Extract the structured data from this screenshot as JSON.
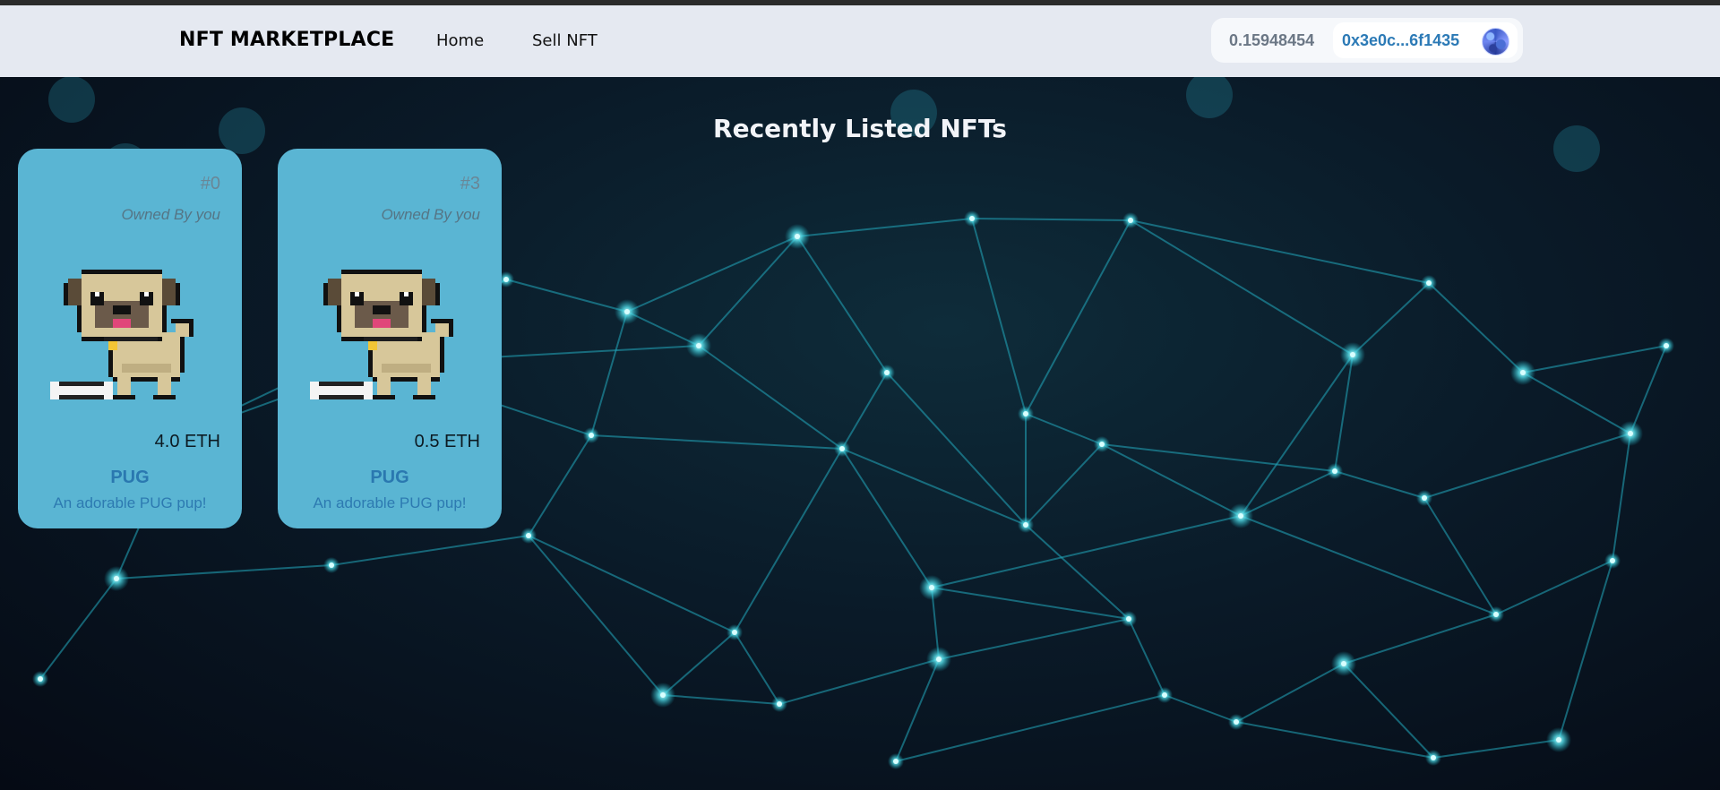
{
  "navbar": {
    "brand": "NFT MARKETPLACE",
    "links": [
      {
        "label": "Home"
      },
      {
        "label": "Sell NFT"
      }
    ],
    "wallet": {
      "balance": "0.15948454",
      "address": "0x3e0c...6f1435"
    }
  },
  "main": {
    "title": "Recently Listed NFTs",
    "cards": [
      {
        "token_id": "#0",
        "owner": "Owned By you",
        "price": "4.0 ETH",
        "name": "PUG",
        "description": "An adorable PUG pup!",
        "image": "pug-pixel-art"
      },
      {
        "token_id": "#3",
        "owner": "Owned By you",
        "price": "0.5 ETH",
        "name": "PUG",
        "description": "An adorable PUG pup!",
        "image": "pug-pixel-art"
      }
    ]
  },
  "colors": {
    "navbar_bg": "#e5e9f1",
    "card_bg": "#5ab5d3",
    "accent_blue": "#2c7ab6",
    "hero_bg": "#050a14"
  }
}
